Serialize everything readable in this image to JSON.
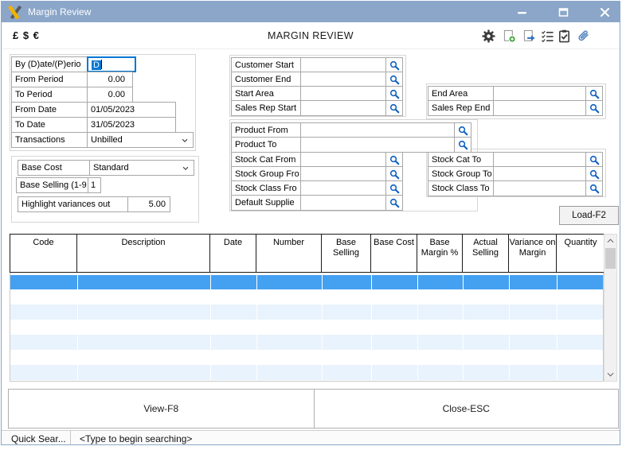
{
  "window": {
    "title": "Margin Review",
    "control_icons": [
      "minimize-icon",
      "maximize-icon",
      "close-icon"
    ]
  },
  "toolbar": {
    "currency_label": "£ $ €",
    "screen_title": "MARGIN REVIEW",
    "icons": [
      "settings-gear-icon",
      "new-record-icon",
      "export-record-icon",
      "checklist-icon",
      "tasks-clipboard-icon",
      "attachment-paperclip-icon"
    ]
  },
  "filters": {
    "period_group": [
      {
        "label": "By (D)ate/(P)erio",
        "value": "D"
      },
      {
        "label": "From Period",
        "value": "0.00"
      },
      {
        "label": "To Period",
        "value": "0.00"
      },
      {
        "label": "From Date",
        "value": "01/05/2023"
      },
      {
        "label": "To Date",
        "value": "31/05/2023"
      },
      {
        "label": "Transactions",
        "value": "Unbilled"
      }
    ],
    "options_group": [
      {
        "label": "Base Cost",
        "value": "Standard"
      },
      {
        "label": "Base Selling (1-9",
        "value": "1"
      },
      {
        "label": "Highlight variances out",
        "value": "5.00"
      }
    ],
    "customer_group": [
      {
        "label": "Customer Start",
        "value": ""
      },
      {
        "label": "Customer End",
        "value": ""
      },
      {
        "label": "Start Area",
        "value": ""
      },
      {
        "label": "Sales Rep Start",
        "value": ""
      }
    ],
    "area_group": [
      {
        "label": "End Area",
        "value": ""
      },
      {
        "label": "Sales Rep End",
        "value": ""
      }
    ],
    "product_group": [
      {
        "label": "Product From",
        "value": ""
      },
      {
        "label": "Product To",
        "value": ""
      },
      {
        "label": "Stock Cat From",
        "value": ""
      },
      {
        "label": "Stock Group Fro",
        "value": ""
      },
      {
        "label": "Stock Class Fro",
        "value": ""
      },
      {
        "label": "Default Supplie",
        "value": ""
      }
    ],
    "stock_to_group": [
      {
        "label": "Stock Cat To",
        "value": ""
      },
      {
        "label": "Stock Group To",
        "value": ""
      },
      {
        "label": "Stock Class To",
        "value": ""
      }
    ],
    "load_button": "Load-F2",
    "search_icon": "search-magnifier-icon"
  },
  "table": {
    "columns": [
      "Code",
      "Description",
      "Date",
      "Number",
      "Base Selling",
      "Base Cost",
      "Base Margin %",
      "Actual Selling",
      "Variance on Margin",
      "Quantity"
    ],
    "rows": [],
    "visible_empty_rows": 7,
    "selected_row_index": 0
  },
  "footer": {
    "view_button": "View-F8",
    "close_button": "Close-ESC"
  },
  "statusbar": {
    "label": "Quick Sear...",
    "hint": "<Type to begin searching>"
  },
  "colors": {
    "titlebar": "#8BA6C9",
    "selected_row": "#44A0F1",
    "alt_row": "#E9F3FD",
    "focus_border": "#0077D4",
    "search_icon_blue": "#1060C0",
    "logo_yellow": "#F0B400"
  }
}
